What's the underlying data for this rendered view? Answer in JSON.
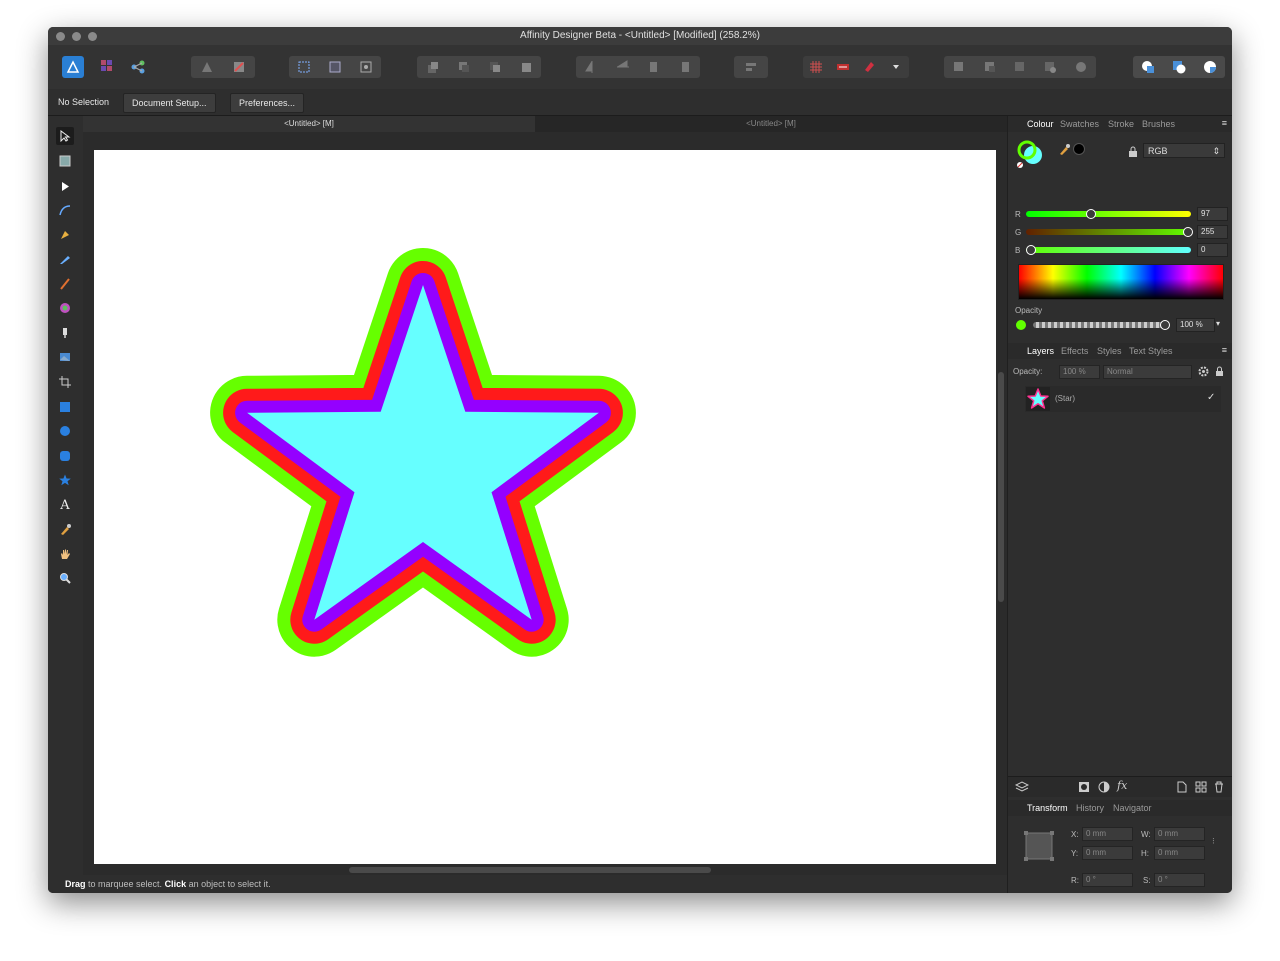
{
  "window": {
    "title": "Affinity Designer Beta - <Untitled> [Modified] (258.2%)"
  },
  "context_toolbar": {
    "selection_label": "No Selection",
    "document_setup_label": "Document Setup...",
    "preferences_label": "Preferences..."
  },
  "document_tabs": [
    {
      "label": "<Untitled> [M]"
    },
    {
      "label": "<Untitled> [M]"
    }
  ],
  "status": {
    "drag": "Drag",
    "drag_rest": " to marquee select. ",
    "click": "Click",
    "click_rest": " an object to select it."
  },
  "colour_panel": {
    "tabs": [
      "Colour",
      "Swatches",
      "Stroke",
      "Brushes"
    ],
    "model": "RGB",
    "channels": [
      {
        "label": "R",
        "value": "97",
        "fraction": 0.38
      },
      {
        "label": "G",
        "value": "255",
        "fraction": 1.0
      },
      {
        "label": "B",
        "value": "0",
        "fraction": 0.0
      }
    ],
    "opacity_label": "Opacity",
    "opacity_value": "100 %",
    "current_color": "#61ff00"
  },
  "layers_panel": {
    "tabs": [
      "Layers",
      "Effects",
      "Styles",
      "Text Styles"
    ],
    "opacity_label": "Opacity:",
    "opacity_value": "100 %",
    "blend_mode": "Normal",
    "layers": [
      {
        "name": "(Star)",
        "visible_check": "✓"
      }
    ]
  },
  "transform_panel": {
    "tabs": [
      "Transform",
      "History",
      "Navigator"
    ],
    "x_label": "X:",
    "x_value": "0 mm",
    "y_label": "Y:",
    "y_value": "0 mm",
    "w_label": "W:",
    "w_value": "0 mm",
    "h_label": "H:",
    "h_value": "0 mm",
    "r_label": "R:",
    "r_value": "0 °",
    "s_label": "S:",
    "s_value": "0 °"
  },
  "star_colors": {
    "outer_stroke": "#66ff00",
    "middle_stroke": "#ff1a1a",
    "inner_stroke": "#9400ff",
    "fill": "#66ffff"
  }
}
